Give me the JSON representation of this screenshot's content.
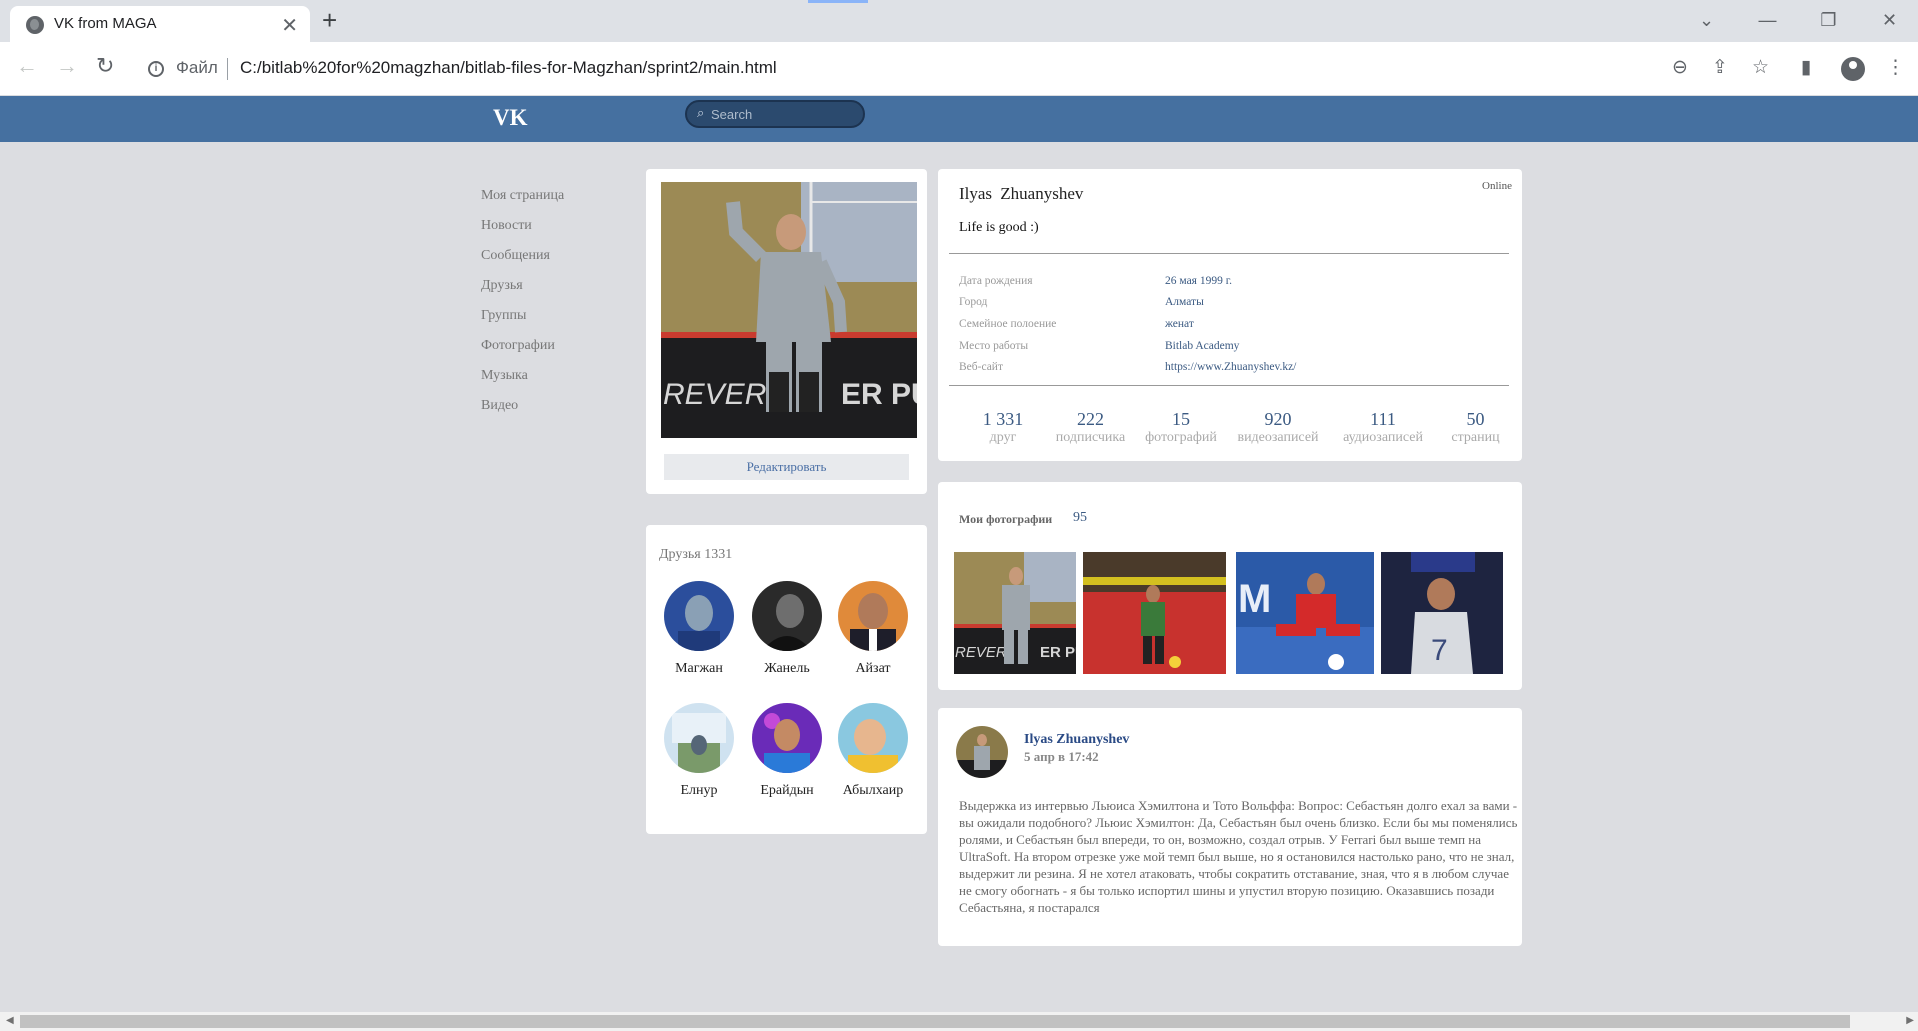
{
  "browser": {
    "tab_title": "VK from MAGA",
    "file_label": "Файл",
    "url": "C:/bitlab%20for%20magzhan/bitlab-files-for-Magzhan/sprint2/main.html"
  },
  "header": {
    "logo": "VK",
    "search_placeholder": "Search",
    "bg_color": "#4570a0"
  },
  "nav": {
    "items": [
      {
        "label": "Моя страница"
      },
      {
        "label": "Новости"
      },
      {
        "label": "Сообщения"
      },
      {
        "label": "Друзья"
      },
      {
        "label": "Группы"
      },
      {
        "label": "Фотографии"
      },
      {
        "label": "Музыка"
      },
      {
        "label": "Видео"
      }
    ]
  },
  "profile": {
    "edit_label": "Редактировать",
    "name": "Ilyas  Zhuanyshev",
    "status": "Life is good :)",
    "online": "Online",
    "info": [
      {
        "key": "Дата рождения",
        "value": "26 мая 1999 г."
      },
      {
        "key": "Город",
        "value": "Алматы"
      },
      {
        "key": "Семейное полоение",
        "value": "женат"
      },
      {
        "key": "Место работы",
        "value": "Bitlab Academy"
      },
      {
        "key": "Веб-сайт",
        "value": "https://www.Zhuanyshev.kz/"
      }
    ],
    "stats": [
      {
        "n": "1 331",
        "l": "друг"
      },
      {
        "n": "222",
        "l": "подписчика"
      },
      {
        "n": "15",
        "l": "фотографий"
      },
      {
        "n": "920",
        "l": "видеозаписей"
      },
      {
        "n": "111",
        "l": "аудиозаписей"
      },
      {
        "n": "50",
        "l": "страниц"
      }
    ]
  },
  "friends": {
    "title": "Друзья 1331",
    "list": [
      {
        "name": "Магжан"
      },
      {
        "name": "Жанель"
      },
      {
        "name": "Айзат"
      },
      {
        "name": "Елнур"
      },
      {
        "name": "Ерайдын"
      },
      {
        "name": "Абылхаир"
      }
    ]
  },
  "photos": {
    "title": "Мои фотографии",
    "count": "95"
  },
  "post": {
    "author": "Ilyas Zhuanyshev",
    "date": "5 апр в 17:42",
    "text": "Выдержка из интервью Льюиса Хэмилтона и Тото Вольффа: Вопрос: Себастьян долго ехал за вами - вы ожидали подобного? Льюис Хэмилтон: Да, Себастьян был очень близко. Если бы мы поменялись ролями, и Себастьян был впереди, то он, возможно, создал отрыв. У Ferrari был выше темп на UltraSoft. На втором отрезке уже мой темп был выше, но я остановился настолько рано, что не знал, выдержит ли резина. Я не хотел атаковать, чтобы сократить отставание, зная, что я в любом случае не смогу обогнать - я бы только испортил шины и упустил вторую позицию. Оказавшись позади Себастьяна, я постарался"
  }
}
